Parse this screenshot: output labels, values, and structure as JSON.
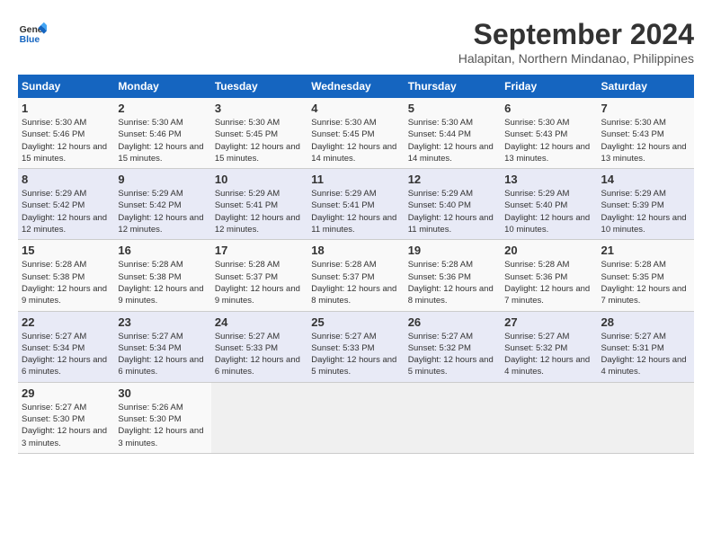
{
  "header": {
    "logo_line1": "General",
    "logo_line2": "Blue",
    "month": "September 2024",
    "location": "Halapitan, Northern Mindanao, Philippines"
  },
  "weekdays": [
    "Sunday",
    "Monday",
    "Tuesday",
    "Wednesday",
    "Thursday",
    "Friday",
    "Saturday"
  ],
  "weeks": [
    [
      {
        "day": "1",
        "sunrise": "5:30 AM",
        "sunset": "5:46 PM",
        "daylight": "12 hours and 15 minutes."
      },
      {
        "day": "2",
        "sunrise": "5:30 AM",
        "sunset": "5:46 PM",
        "daylight": "12 hours and 15 minutes."
      },
      {
        "day": "3",
        "sunrise": "5:30 AM",
        "sunset": "5:45 PM",
        "daylight": "12 hours and 15 minutes."
      },
      {
        "day": "4",
        "sunrise": "5:30 AM",
        "sunset": "5:45 PM",
        "daylight": "12 hours and 14 minutes."
      },
      {
        "day": "5",
        "sunrise": "5:30 AM",
        "sunset": "5:44 PM",
        "daylight": "12 hours and 14 minutes."
      },
      {
        "day": "6",
        "sunrise": "5:30 AM",
        "sunset": "5:43 PM",
        "daylight": "12 hours and 13 minutes."
      },
      {
        "day": "7",
        "sunrise": "5:30 AM",
        "sunset": "5:43 PM",
        "daylight": "12 hours and 13 minutes."
      }
    ],
    [
      {
        "day": "8",
        "sunrise": "5:29 AM",
        "sunset": "5:42 PM",
        "daylight": "12 hours and 12 minutes."
      },
      {
        "day": "9",
        "sunrise": "5:29 AM",
        "sunset": "5:42 PM",
        "daylight": "12 hours and 12 minutes."
      },
      {
        "day": "10",
        "sunrise": "5:29 AM",
        "sunset": "5:41 PM",
        "daylight": "12 hours and 12 minutes."
      },
      {
        "day": "11",
        "sunrise": "5:29 AM",
        "sunset": "5:41 PM",
        "daylight": "12 hours and 11 minutes."
      },
      {
        "day": "12",
        "sunrise": "5:29 AM",
        "sunset": "5:40 PM",
        "daylight": "12 hours and 11 minutes."
      },
      {
        "day": "13",
        "sunrise": "5:29 AM",
        "sunset": "5:40 PM",
        "daylight": "12 hours and 10 minutes."
      },
      {
        "day": "14",
        "sunrise": "5:29 AM",
        "sunset": "5:39 PM",
        "daylight": "12 hours and 10 minutes."
      }
    ],
    [
      {
        "day": "15",
        "sunrise": "5:28 AM",
        "sunset": "5:38 PM",
        "daylight": "12 hours and 9 minutes."
      },
      {
        "day": "16",
        "sunrise": "5:28 AM",
        "sunset": "5:38 PM",
        "daylight": "12 hours and 9 minutes."
      },
      {
        "day": "17",
        "sunrise": "5:28 AM",
        "sunset": "5:37 PM",
        "daylight": "12 hours and 9 minutes."
      },
      {
        "day": "18",
        "sunrise": "5:28 AM",
        "sunset": "5:37 PM",
        "daylight": "12 hours and 8 minutes."
      },
      {
        "day": "19",
        "sunrise": "5:28 AM",
        "sunset": "5:36 PM",
        "daylight": "12 hours and 8 minutes."
      },
      {
        "day": "20",
        "sunrise": "5:28 AM",
        "sunset": "5:36 PM",
        "daylight": "12 hours and 7 minutes."
      },
      {
        "day": "21",
        "sunrise": "5:28 AM",
        "sunset": "5:35 PM",
        "daylight": "12 hours and 7 minutes."
      }
    ],
    [
      {
        "day": "22",
        "sunrise": "5:27 AM",
        "sunset": "5:34 PM",
        "daylight": "12 hours and 6 minutes."
      },
      {
        "day": "23",
        "sunrise": "5:27 AM",
        "sunset": "5:34 PM",
        "daylight": "12 hours and 6 minutes."
      },
      {
        "day": "24",
        "sunrise": "5:27 AM",
        "sunset": "5:33 PM",
        "daylight": "12 hours and 6 minutes."
      },
      {
        "day": "25",
        "sunrise": "5:27 AM",
        "sunset": "5:33 PM",
        "daylight": "12 hours and 5 minutes."
      },
      {
        "day": "26",
        "sunrise": "5:27 AM",
        "sunset": "5:32 PM",
        "daylight": "12 hours and 5 minutes."
      },
      {
        "day": "27",
        "sunrise": "5:27 AM",
        "sunset": "5:32 PM",
        "daylight": "12 hours and 4 minutes."
      },
      {
        "day": "28",
        "sunrise": "5:27 AM",
        "sunset": "5:31 PM",
        "daylight": "12 hours and 4 minutes."
      }
    ],
    [
      {
        "day": "29",
        "sunrise": "5:27 AM",
        "sunset": "5:30 PM",
        "daylight": "12 hours and 3 minutes."
      },
      {
        "day": "30",
        "sunrise": "5:26 AM",
        "sunset": "5:30 PM",
        "daylight": "12 hours and 3 minutes."
      },
      null,
      null,
      null,
      null,
      null
    ]
  ]
}
